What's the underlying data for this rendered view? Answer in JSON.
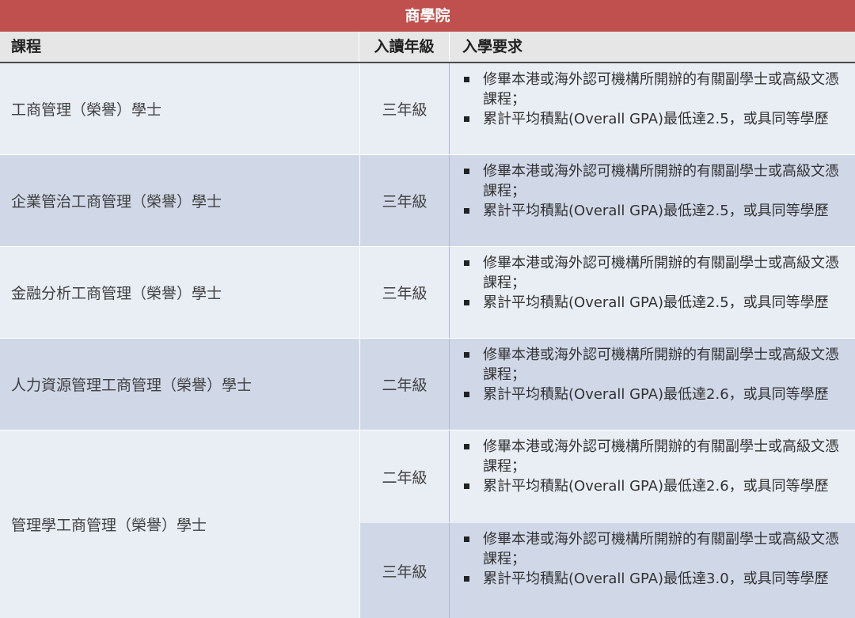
{
  "title": "商學院",
  "headers": {
    "course": "課程",
    "year": "入讀年級",
    "requirements": "入學要求"
  },
  "rows": [
    {
      "course": "工商管理（榮譽）學士",
      "year": "三年級",
      "req1": "修畢本港或海外認可機構所開辦的有關副學士或高級文憑課程；",
      "req2": "累計平均積點(Overall GPA)最低達2.5，或具同等學歷"
    },
    {
      "course": "企業管治工商管理（榮譽）學士",
      "year": "三年級",
      "req1": "修畢本港或海外認可機構所開辦的有關副學士或高級文憑課程；",
      "req2": "累計平均積點(Overall GPA)最低達2.5，或具同等學歷"
    },
    {
      "course": "金融分析工商管理（榮譽）學士",
      "year": "三年級",
      "req1": "修畢本港或海外認可機構所開辦的有關副學士或高級文憑課程；",
      "req2": "累計平均積點(Overall GPA)最低達2.5，或具同等學歷"
    },
    {
      "course": "人力資源管理工商管理（榮譽）學士",
      "year": "二年級",
      "req1": "修畢本港或海外認可機構所開辦的有關副學士或高級文憑課程；",
      "req2": "累計平均積點(Overall GPA)最低達2.6，或具同等學歷"
    }
  ],
  "merged_row": {
    "course": "管理學工商管理（榮譽）學士",
    "entries": [
      {
        "year": "二年級",
        "req1": "修畢本港或海外認可機構所開辦的有關副學士或高級文憑課程；",
        "req2": "累計平均積點(Overall GPA)最低達2.6，或具同等學歷"
      },
      {
        "year": "三年級",
        "req1": "修畢本港或海外認可機構所開辦的有關副學士或高級文憑課程；",
        "req2": "累計平均積點(Overall GPA)最低達3.0，或具同等學歷"
      }
    ]
  },
  "colors": {
    "title_bg": "#c0504d",
    "header_bg": "#e6e6e6",
    "row_light": "#e9edf4",
    "row_dark": "#d0d8e8"
  }
}
